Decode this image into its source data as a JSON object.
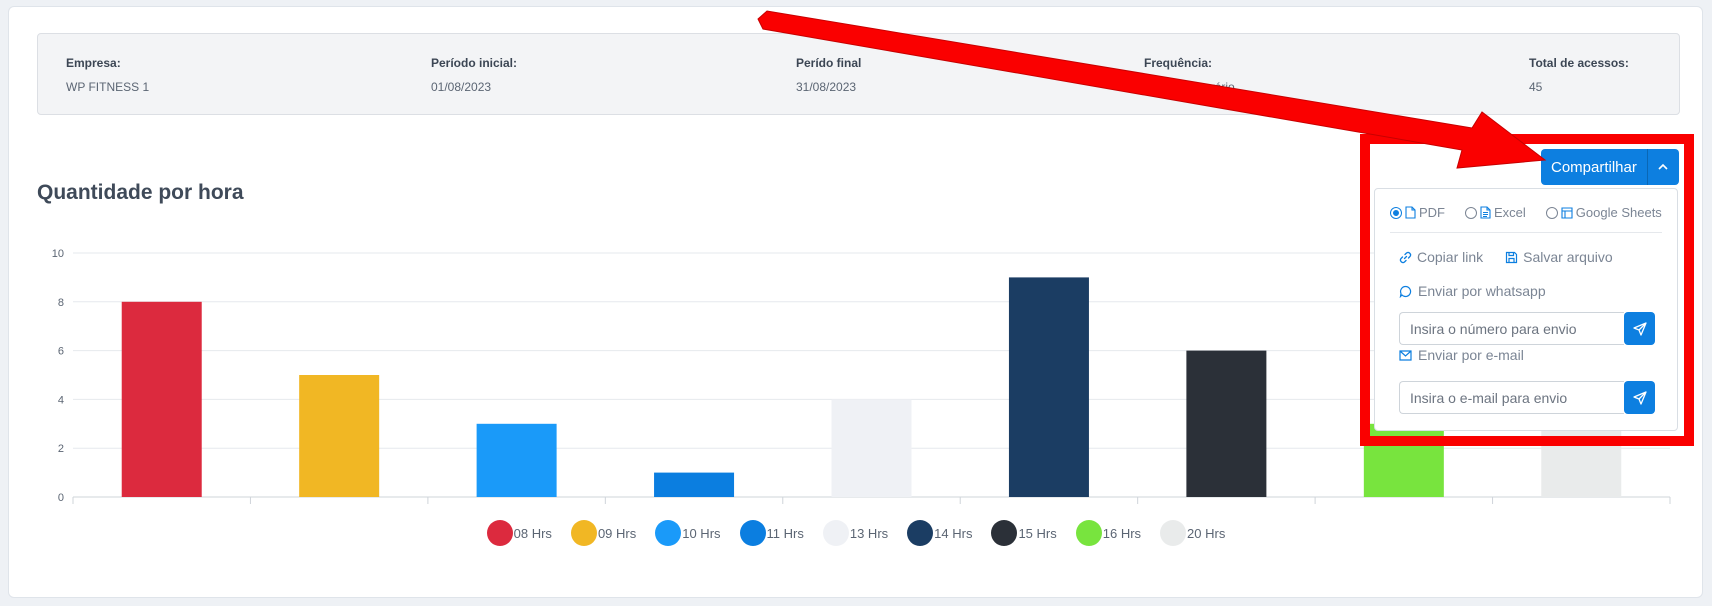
{
  "filters": [
    {
      "label": "Empresa:",
      "value": "WP FITNESS 1"
    },
    {
      "label": "Período inicial:",
      "value": "01/08/2023"
    },
    {
      "label": "Perído final",
      "value": "31/08/2023"
    },
    {
      "label": "Frequência:",
      "value": "Geral por horário"
    },
    {
      "label": "Total de acessos:",
      "value": "45"
    }
  ],
  "share": {
    "button_label": "Compartilhar",
    "toggle_icon": "chevron-up-icon",
    "formats": [
      {
        "label": "PDF",
        "selected": true,
        "icon": "file-icon"
      },
      {
        "label": "Excel",
        "selected": false,
        "icon": "file-text-icon"
      },
      {
        "label": "Google Sheets",
        "selected": false,
        "icon": "table-icon"
      }
    ],
    "copy_link": "Copiar link",
    "save_file": "Salvar arquivo",
    "whatsapp_label": "Enviar por whatsapp",
    "whatsapp_placeholder": "Insira o número para envio",
    "email_label": "Enviar por e-mail",
    "email_placeholder": "Insira o e-mail para envio"
  },
  "chart_data": {
    "type": "bar",
    "title": "Quantidade por hora",
    "categories": [
      "08 Hrs",
      "09 Hrs",
      "10 Hrs",
      "11 Hrs",
      "13 Hrs",
      "14 Hrs",
      "15 Hrs",
      "16 Hrs",
      "20 Hrs"
    ],
    "values": [
      8,
      5,
      3,
      1,
      4,
      9,
      6,
      3,
      3
    ],
    "colors": [
      "#dc2a3e",
      "#f1b724",
      "#1a9af9",
      "#0b7ee0",
      "#eff1f5",
      "#1b3d63",
      "#2b3038",
      "#78e43e",
      "#e9ebeb"
    ],
    "ylim": [
      0,
      10
    ],
    "yticks": [
      0,
      2,
      4,
      6,
      8,
      10
    ],
    "grid": true,
    "legend": "bottom"
  }
}
